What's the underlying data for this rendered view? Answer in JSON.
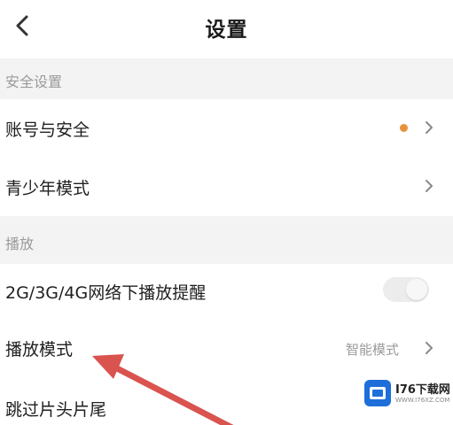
{
  "header": {
    "title": "设置",
    "back_icon": "chevron-left-icon"
  },
  "sections": [
    {
      "title": "安全设置",
      "items": [
        {
          "label": "账号与安全",
          "has_dot": true,
          "dot_color": "#e7923a",
          "control": "chevron"
        },
        {
          "label": "青少年模式",
          "control": "chevron"
        }
      ]
    },
    {
      "title": "播放",
      "items": [
        {
          "label": "2G/3G/4G网络下播放提醒",
          "control": "toggle",
          "toggle_on": false
        },
        {
          "label": "播放模式",
          "value": "智能模式",
          "control": "chevron"
        },
        {
          "label": "跳过片头片尾",
          "control": "toggle"
        }
      ]
    }
  ],
  "annotation": {
    "arrow_color": "#d9534f",
    "arrow_icon": "red-pointer-arrow",
    "target": "播放模式"
  },
  "watermark": {
    "text": "I76下载网",
    "subtext": "WWW.I76XZ.COM",
    "logo_icon": "blue-box-logo-icon"
  },
  "colors": {
    "section_bg": "#f3f3f3",
    "secondary_text": "#9a9a9a",
    "primary_text": "#1f1f1f"
  }
}
